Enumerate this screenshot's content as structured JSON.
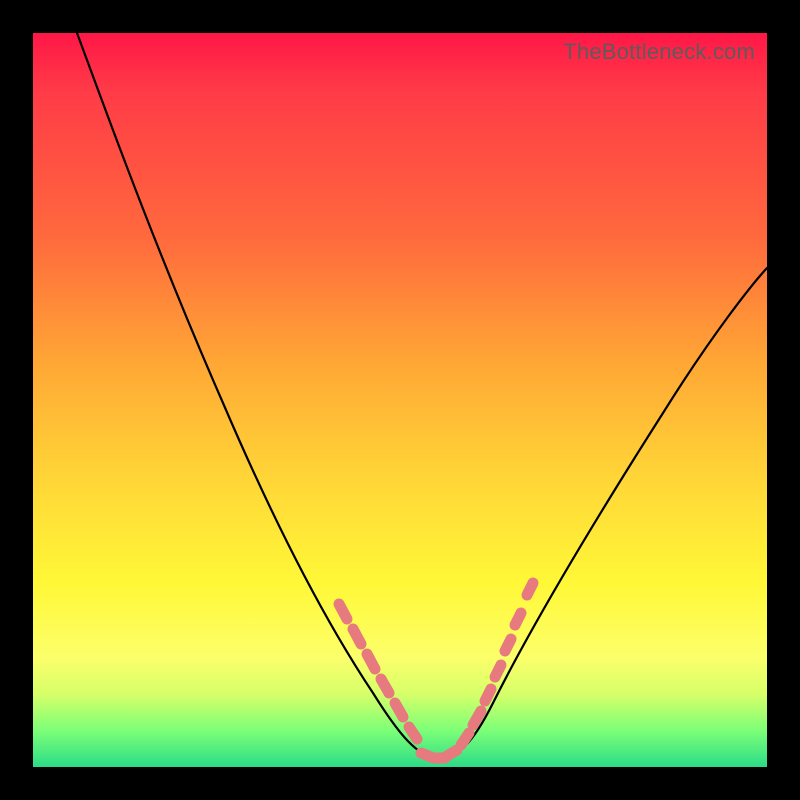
{
  "watermark": "TheBottleneck.com",
  "colors": {
    "background_black": "#000000",
    "gradient_top": "#ff1747",
    "gradient_mid1": "#ff6a3d",
    "gradient_mid2": "#ffd437",
    "gradient_mid3": "#fcff6a",
    "gradient_bottom": "#2bdc87",
    "curve": "#000000",
    "marker": "#e77a7e"
  },
  "chart_data": {
    "type": "line",
    "title": "",
    "xlabel": "",
    "ylabel": "",
    "xlim": [
      0,
      100
    ],
    "ylim": [
      0,
      100
    ],
    "grid": false,
    "legend": false,
    "series": [
      {
        "name": "bottleneck-curve",
        "x": [
          6,
          10,
          15,
          20,
          25,
          30,
          35,
          40,
          44,
          47,
          49,
          51,
          53,
          55,
          58,
          62,
          68,
          75,
          82,
          90,
          98
        ],
        "y": [
          100,
          90,
          78,
          66,
          54,
          43,
          32,
          22,
          14,
          9,
          5,
          2,
          1,
          1,
          3,
          8,
          16,
          27,
          38,
          50,
          60
        ]
      }
    ],
    "markers": [
      {
        "x": 40,
        "y": 22
      },
      {
        "x": 42,
        "y": 18
      },
      {
        "x": 44,
        "y": 14
      },
      {
        "x": 46,
        "y": 10
      },
      {
        "x": 48,
        "y": 6
      },
      {
        "x": 50,
        "y": 3
      },
      {
        "x": 52,
        "y": 1.5
      },
      {
        "x": 54,
        "y": 1
      },
      {
        "x": 56,
        "y": 2
      },
      {
        "x": 58,
        "y": 3.5
      },
      {
        "x": 59,
        "y": 5
      },
      {
        "x": 60,
        "y": 7
      },
      {
        "x": 61,
        "y": 9
      },
      {
        "x": 63,
        "y": 13
      },
      {
        "x": 64,
        "y": 17
      },
      {
        "x": 65,
        "y": 20
      }
    ]
  }
}
